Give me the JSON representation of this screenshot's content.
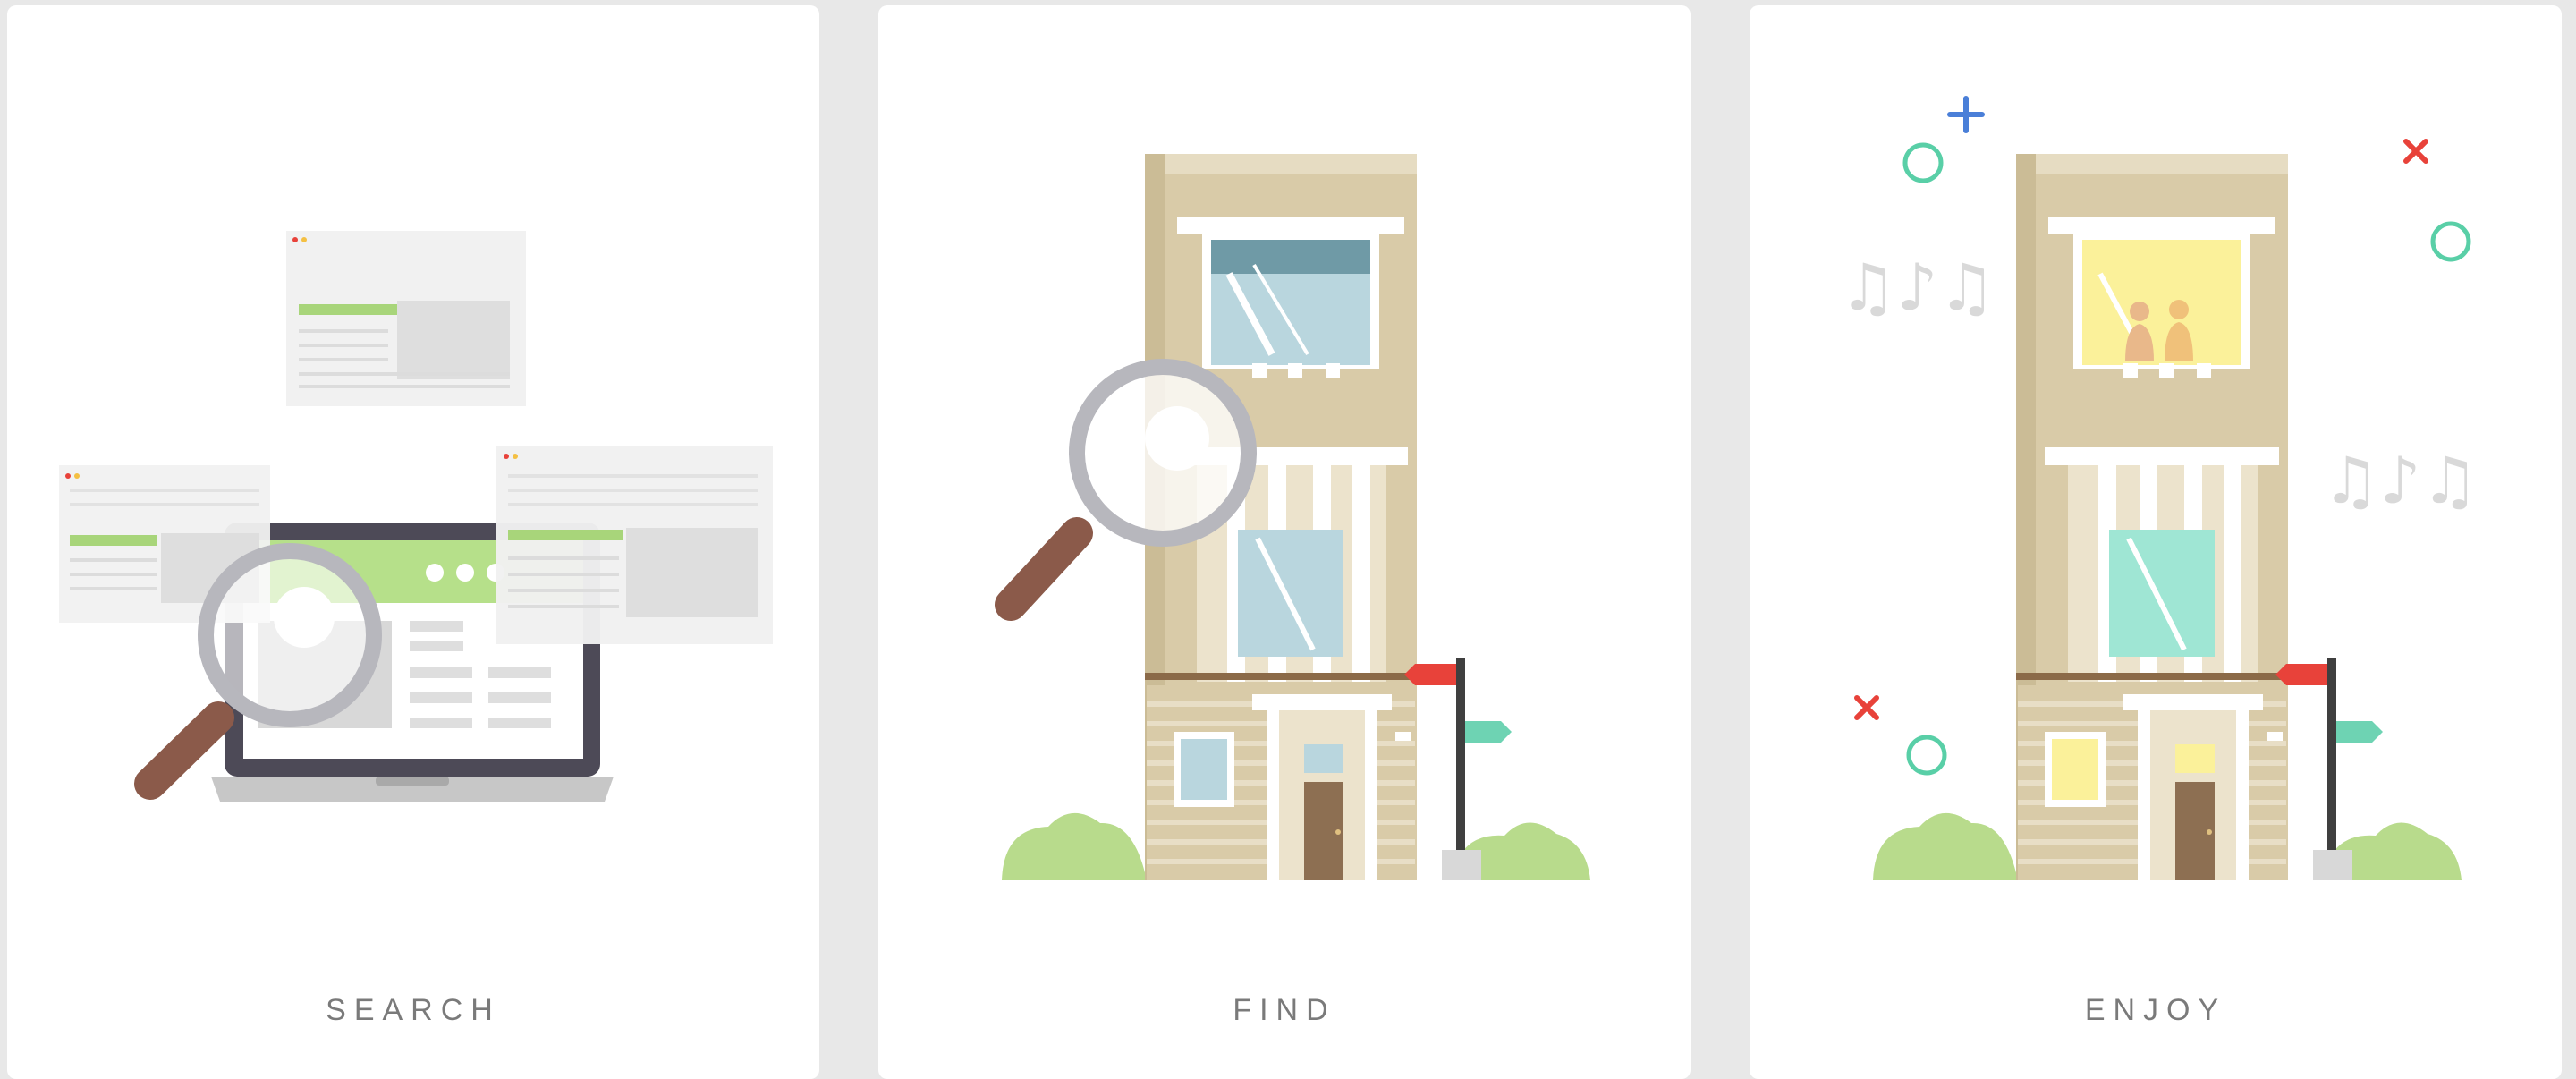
{
  "steps": [
    {
      "label": "SEARCH"
    },
    {
      "label": "FIND"
    },
    {
      "label": "ENJOY"
    }
  ],
  "colors": {
    "background": "#e8e8e8",
    "card": "#ffffff",
    "label": "#7a7a7a",
    "building": "#d9cba8",
    "accent_green": "#a8d57a",
    "flag_red": "#e8423a",
    "flag_teal": "#6ed3b3",
    "magnifier_handle": "#8b5a4a",
    "laptop": "#4d4a57",
    "lit_window": "#fbf19a",
    "teal_window": "#9fe6d4",
    "circle_teal": "#59cfa7",
    "plus_blue": "#4a7fd8"
  },
  "icons": [
    "magnifier-icon",
    "laptop-icon",
    "browser-window-icon",
    "building-icon",
    "signpost-icon",
    "bush-icon",
    "music-note-icon",
    "plus-icon",
    "cross-icon",
    "circle-icon"
  ]
}
